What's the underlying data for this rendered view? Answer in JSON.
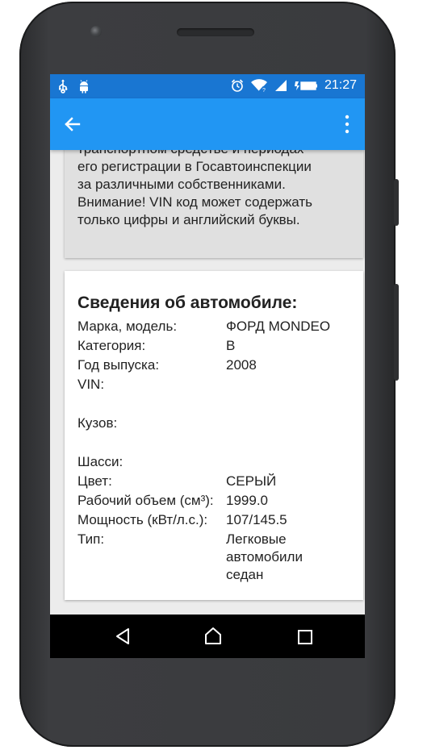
{
  "statusbar": {
    "time": "21:27",
    "left_icons": [
      "usb-icon",
      "android-icon"
    ],
    "right_icons": [
      "alarm-icon",
      "wifi-icon",
      "signal-icon",
      "battery-charging-icon"
    ],
    "color": "#1976d2"
  },
  "appbar": {
    "back_icon": "arrow-left-icon",
    "menu_icon": "more-vert-icon",
    "color": "#2196f3"
  },
  "info_card": {
    "lines": [
      "транспортном средстве и периодах",
      "его регистрации в Госавтоинспекции",
      "за различными собственниками.",
      "Внимание! VIN код может содержать",
      "только цифры и английский буквы."
    ]
  },
  "car_card": {
    "title": "Сведения об автомобиле:",
    "rows": [
      {
        "label": "Марка, модель:",
        "value": "ФОРД MONDEO"
      },
      {
        "label": "Категория:",
        "value": "B"
      },
      {
        "label": "Год выпуска:",
        "value": "2008"
      },
      {
        "label": "VIN:",
        "value": ""
      },
      {
        "label": "Кузов:",
        "value": ""
      },
      {
        "label": "Шасси:",
        "value": ""
      },
      {
        "label": "Цвет:",
        "value": "СЕРЫЙ"
      },
      {
        "label": "Рабочий объем (см³):",
        "value": "1999.0"
      },
      {
        "label": "Мощность (кВт/л.с.):",
        "value": "107/145.5"
      },
      {
        "label": "Тип:",
        "value": "Легковые автомобили седан"
      }
    ]
  },
  "navbar": {
    "icons": [
      "nav-back-icon",
      "nav-home-icon",
      "nav-recent-icon"
    ]
  }
}
